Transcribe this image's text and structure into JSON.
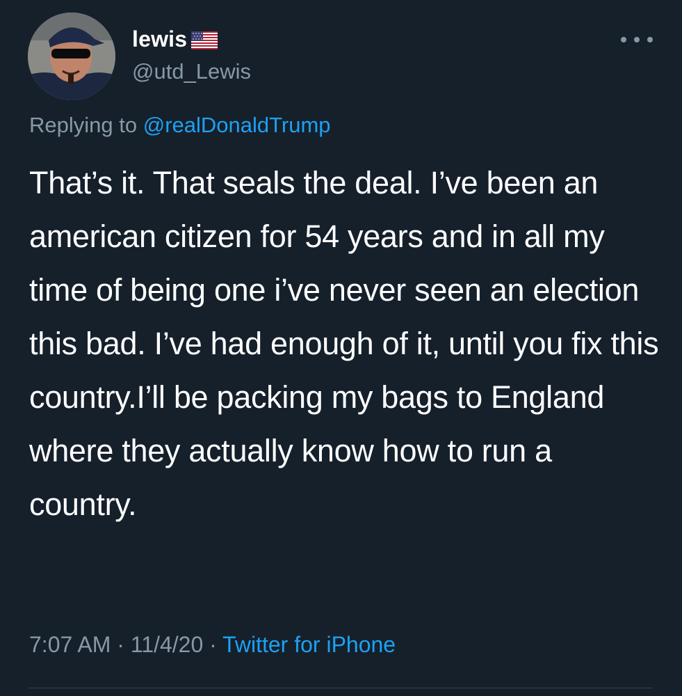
{
  "user": {
    "display_name": "lewis",
    "handle": "@utd_Lewis",
    "flag_icon": "us-flag-icon"
  },
  "reply": {
    "prefix": "Replying to ",
    "mention": "@realDonaldTrump"
  },
  "tweet": {
    "text": "That’s it. That seals the deal. I’ve been an american citizen for 54 years and in all my time of being one i’ve never seen an election this bad. I’ve had enough of it, until you fix this country.I’ll be packing my bags to England where they actually know how to run a country."
  },
  "meta": {
    "time": "7:07 AM",
    "sep1": " · ",
    "date": "11/4/20",
    "sep2": " · ",
    "source": "Twitter for iPhone"
  },
  "colors": {
    "background": "#15202b",
    "secondary_text": "#8899a6",
    "link": "#1da1f2"
  }
}
